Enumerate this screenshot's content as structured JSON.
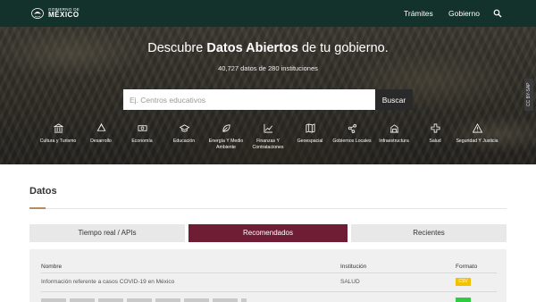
{
  "navbar": {
    "logo_small": "GOBIERNO DE",
    "logo_big": "MÉXICO",
    "links": [
      "Trámites",
      "Gobierno"
    ],
    "search_icon": "search-icon"
  },
  "hero": {
    "title_pre": "Descubre ",
    "title_bold": "Datos Abiertos",
    "title_post": " de tu gobierno.",
    "subtitle": "40,727 datos de 280 instituciones",
    "search_placeholder": "Ej. Centros educativos",
    "search_button": "Buscar",
    "photo_credit": "CC BY-SAP"
  },
  "categories": [
    {
      "label": "Cultura y Turismo",
      "icon": "landmark-icon"
    },
    {
      "label": "Desarrollo",
      "icon": "recycle-icon"
    },
    {
      "label": "Economía",
      "icon": "money-icon"
    },
    {
      "label": "Educación",
      "icon": "graduation-cap-icon"
    },
    {
      "label": "Energía Y Medio Ambiente",
      "icon": "leaf-icon"
    },
    {
      "label": "Finanzas Y Contrataciones",
      "icon": "line-chart-icon"
    },
    {
      "label": "Geoespacial",
      "icon": "map-icon"
    },
    {
      "label": "Gobiernos Locales",
      "icon": "network-icon"
    },
    {
      "label": "Infraestructura",
      "icon": "building-icon"
    },
    {
      "label": "Salud",
      "icon": "health-cross-icon"
    },
    {
      "label": "Seguridad Y Justicia",
      "icon": "warning-icon"
    }
  ],
  "datos": {
    "title": "Datos",
    "tabs": [
      "Tiempo real / APIs",
      "Recomendados",
      "Recientes"
    ],
    "active_tab": "Recomendados",
    "columns": [
      "Nombre",
      "Institución",
      "Formato"
    ],
    "rows": [
      {
        "name": "Información referente a casos COVID-19 en México",
        "institution": "SALUD",
        "format": "CSV"
      }
    ]
  },
  "colors": {
    "navbar": "#13322b",
    "active_tab": "#6f1d35",
    "accent_gold": "#b38e5d",
    "badge_csv": "#f2c200"
  }
}
